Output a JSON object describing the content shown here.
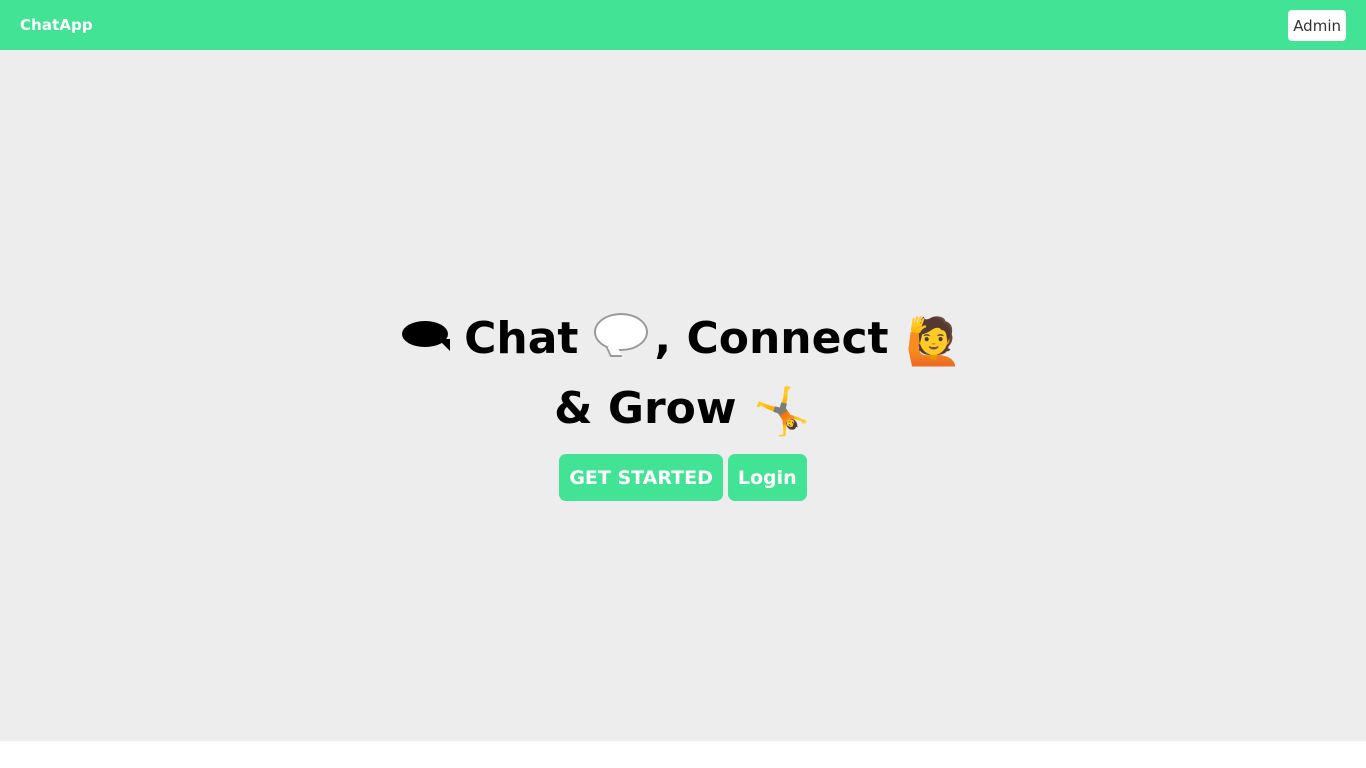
{
  "navbar": {
    "brand": "ChatApp",
    "admin_label": "Admin",
    "background": "#43e396"
  },
  "hero": {
    "line1_word1": "Chat",
    "line1_separator": ", Connect",
    "line2_text": "& Grow",
    "emoji_raising_hand": "🙋",
    "emoji_cartwheel": "🤸",
    "icons": [
      "black-speech-bubble-icon",
      "white-speech-bubble-icon",
      "person-raising-hand-icon",
      "cartwheel-icon"
    ],
    "background": "#ededed"
  },
  "actions": {
    "get_started_label": "GET STARTED",
    "login_label": "Login",
    "accent": "#43e396"
  }
}
